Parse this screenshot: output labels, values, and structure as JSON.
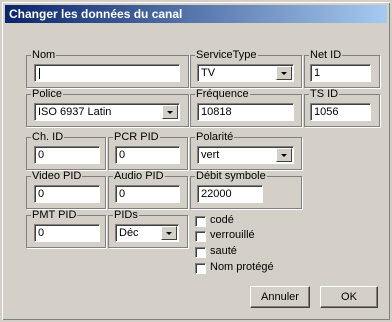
{
  "window": {
    "title": "Changer les données du canal"
  },
  "groups": {
    "nom": {
      "label": "Nom",
      "value": ""
    },
    "service_type": {
      "label": "ServiceType",
      "value": "TV"
    },
    "net_id": {
      "label": "Net ID",
      "value": "1"
    },
    "police": {
      "label": "Police",
      "value": "ISO 6937 Latin"
    },
    "frequence": {
      "label": "Fréquence",
      "value": "10818"
    },
    "ts_id": {
      "label": "TS ID",
      "value": "1056"
    },
    "ch_id": {
      "label": "Ch. ID",
      "value": "0"
    },
    "pcr_pid": {
      "label": "PCR PID",
      "value": "0"
    },
    "polarite": {
      "label": "Polarité",
      "value": "vert"
    },
    "video_pid": {
      "label": "Video PID",
      "value": "0"
    },
    "audio_pid": {
      "label": "Audio PID",
      "value": "0"
    },
    "debit_symbole": {
      "label": "Débit symbole",
      "value": "22000"
    },
    "pmt_pid": {
      "label": "PMT PID",
      "value": "0"
    },
    "pids": {
      "label": "PIDs",
      "value": "Déc"
    }
  },
  "checkboxes": [
    {
      "label": "codé",
      "checked": false
    },
    {
      "label": "verrouillé",
      "checked": false
    },
    {
      "label": "sauté",
      "checked": false
    },
    {
      "label": "Nom protégé",
      "checked": false
    }
  ],
  "buttons": {
    "cancel": "Annuler",
    "ok": "OK"
  }
}
